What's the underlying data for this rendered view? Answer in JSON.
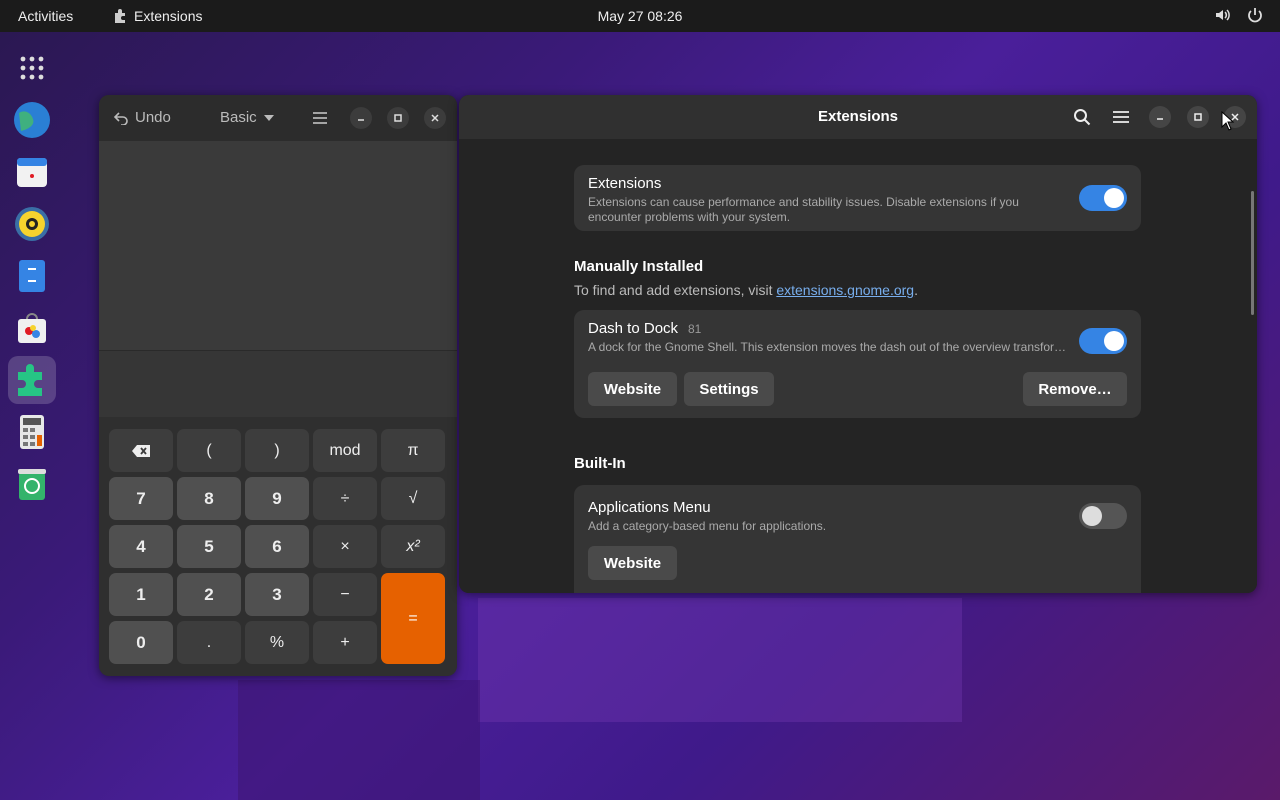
{
  "topbar": {
    "activities": "Activities",
    "app_name": "Extensions",
    "clock": "May 27  08:26"
  },
  "dock": {
    "items": [
      "app-grid",
      "browser",
      "calendar",
      "music",
      "files",
      "software",
      "extensions",
      "calculator",
      "recycle"
    ]
  },
  "calculator": {
    "undo_label": "Undo",
    "mode_label": "Basic",
    "keys": {
      "row1": [
        "⌫",
        "(",
        ")",
        "mod",
        "π"
      ],
      "row2": [
        "7",
        "8",
        "9",
        "÷",
        "√"
      ],
      "row3": [
        "4",
        "5",
        "6",
        "×",
        "x²"
      ],
      "row4": [
        "1",
        "2",
        "3",
        "−",
        "="
      ],
      "row5": [
        "0",
        ".",
        "%",
        "+"
      ]
    }
  },
  "extensions_window": {
    "title": "Extensions",
    "master": {
      "title": "Extensions",
      "description": "Extensions can cause performance and stability issues. Disable extensions if you encounter problems with your system.",
      "enabled": true
    },
    "manual_heading": "Manually Installed",
    "manual_hint_prefix": "To find and add extensions, visit ",
    "manual_hint_link": "extensions.gnome.org",
    "manual_hint_suffix": ".",
    "dash_to_dock": {
      "name": "Dash to Dock",
      "version": "81",
      "description": "A dock for the Gnome Shell. This extension moves the dash out of the overview transfor…",
      "enabled": true,
      "website": "Website",
      "settings": "Settings",
      "remove": "Remove…"
    },
    "builtin_heading": "Built-In",
    "apps_menu": {
      "name": "Applications Menu",
      "description": "Add a category-based menu for applications.",
      "enabled": false,
      "website": "Website"
    }
  },
  "colors": {
    "accent": "#3584e4",
    "equals": "#e66100"
  }
}
